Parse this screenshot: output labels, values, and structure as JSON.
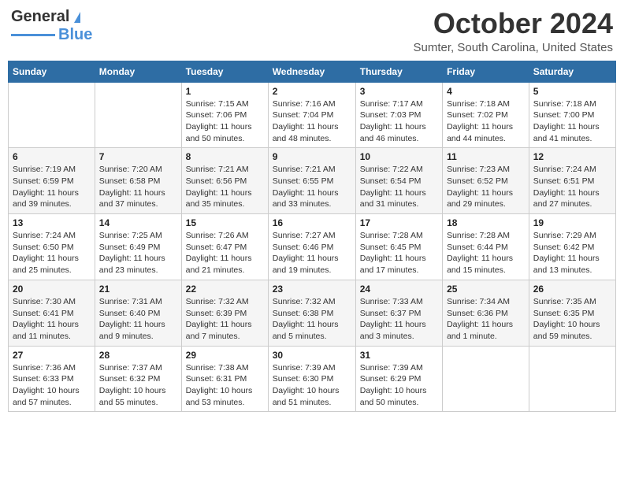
{
  "header": {
    "logo_line1": "General",
    "logo_line2": "Blue",
    "month": "October 2024",
    "location": "Sumter, South Carolina, United States"
  },
  "days_of_week": [
    "Sunday",
    "Monday",
    "Tuesday",
    "Wednesday",
    "Thursday",
    "Friday",
    "Saturday"
  ],
  "weeks": [
    [
      {
        "day": "",
        "sunrise": "",
        "sunset": "",
        "daylight": ""
      },
      {
        "day": "",
        "sunrise": "",
        "sunset": "",
        "daylight": ""
      },
      {
        "day": "1",
        "sunrise": "Sunrise: 7:15 AM",
        "sunset": "Sunset: 7:06 PM",
        "daylight": "Daylight: 11 hours and 50 minutes."
      },
      {
        "day": "2",
        "sunrise": "Sunrise: 7:16 AM",
        "sunset": "Sunset: 7:04 PM",
        "daylight": "Daylight: 11 hours and 48 minutes."
      },
      {
        "day": "3",
        "sunrise": "Sunrise: 7:17 AM",
        "sunset": "Sunset: 7:03 PM",
        "daylight": "Daylight: 11 hours and 46 minutes."
      },
      {
        "day": "4",
        "sunrise": "Sunrise: 7:18 AM",
        "sunset": "Sunset: 7:02 PM",
        "daylight": "Daylight: 11 hours and 44 minutes."
      },
      {
        "day": "5",
        "sunrise": "Sunrise: 7:18 AM",
        "sunset": "Sunset: 7:00 PM",
        "daylight": "Daylight: 11 hours and 41 minutes."
      }
    ],
    [
      {
        "day": "6",
        "sunrise": "Sunrise: 7:19 AM",
        "sunset": "Sunset: 6:59 PM",
        "daylight": "Daylight: 11 hours and 39 minutes."
      },
      {
        "day": "7",
        "sunrise": "Sunrise: 7:20 AM",
        "sunset": "Sunset: 6:58 PM",
        "daylight": "Daylight: 11 hours and 37 minutes."
      },
      {
        "day": "8",
        "sunrise": "Sunrise: 7:21 AM",
        "sunset": "Sunset: 6:56 PM",
        "daylight": "Daylight: 11 hours and 35 minutes."
      },
      {
        "day": "9",
        "sunrise": "Sunrise: 7:21 AM",
        "sunset": "Sunset: 6:55 PM",
        "daylight": "Daylight: 11 hours and 33 minutes."
      },
      {
        "day": "10",
        "sunrise": "Sunrise: 7:22 AM",
        "sunset": "Sunset: 6:54 PM",
        "daylight": "Daylight: 11 hours and 31 minutes."
      },
      {
        "day": "11",
        "sunrise": "Sunrise: 7:23 AM",
        "sunset": "Sunset: 6:52 PM",
        "daylight": "Daylight: 11 hours and 29 minutes."
      },
      {
        "day": "12",
        "sunrise": "Sunrise: 7:24 AM",
        "sunset": "Sunset: 6:51 PM",
        "daylight": "Daylight: 11 hours and 27 minutes."
      }
    ],
    [
      {
        "day": "13",
        "sunrise": "Sunrise: 7:24 AM",
        "sunset": "Sunset: 6:50 PM",
        "daylight": "Daylight: 11 hours and 25 minutes."
      },
      {
        "day": "14",
        "sunrise": "Sunrise: 7:25 AM",
        "sunset": "Sunset: 6:49 PM",
        "daylight": "Daylight: 11 hours and 23 minutes."
      },
      {
        "day": "15",
        "sunrise": "Sunrise: 7:26 AM",
        "sunset": "Sunset: 6:47 PM",
        "daylight": "Daylight: 11 hours and 21 minutes."
      },
      {
        "day": "16",
        "sunrise": "Sunrise: 7:27 AM",
        "sunset": "Sunset: 6:46 PM",
        "daylight": "Daylight: 11 hours and 19 minutes."
      },
      {
        "day": "17",
        "sunrise": "Sunrise: 7:28 AM",
        "sunset": "Sunset: 6:45 PM",
        "daylight": "Daylight: 11 hours and 17 minutes."
      },
      {
        "day": "18",
        "sunrise": "Sunrise: 7:28 AM",
        "sunset": "Sunset: 6:44 PM",
        "daylight": "Daylight: 11 hours and 15 minutes."
      },
      {
        "day": "19",
        "sunrise": "Sunrise: 7:29 AM",
        "sunset": "Sunset: 6:42 PM",
        "daylight": "Daylight: 11 hours and 13 minutes."
      }
    ],
    [
      {
        "day": "20",
        "sunrise": "Sunrise: 7:30 AM",
        "sunset": "Sunset: 6:41 PM",
        "daylight": "Daylight: 11 hours and 11 minutes."
      },
      {
        "day": "21",
        "sunrise": "Sunrise: 7:31 AM",
        "sunset": "Sunset: 6:40 PM",
        "daylight": "Daylight: 11 hours and 9 minutes."
      },
      {
        "day": "22",
        "sunrise": "Sunrise: 7:32 AM",
        "sunset": "Sunset: 6:39 PM",
        "daylight": "Daylight: 11 hours and 7 minutes."
      },
      {
        "day": "23",
        "sunrise": "Sunrise: 7:32 AM",
        "sunset": "Sunset: 6:38 PM",
        "daylight": "Daylight: 11 hours and 5 minutes."
      },
      {
        "day": "24",
        "sunrise": "Sunrise: 7:33 AM",
        "sunset": "Sunset: 6:37 PM",
        "daylight": "Daylight: 11 hours and 3 minutes."
      },
      {
        "day": "25",
        "sunrise": "Sunrise: 7:34 AM",
        "sunset": "Sunset: 6:36 PM",
        "daylight": "Daylight: 11 hours and 1 minute."
      },
      {
        "day": "26",
        "sunrise": "Sunrise: 7:35 AM",
        "sunset": "Sunset: 6:35 PM",
        "daylight": "Daylight: 10 hours and 59 minutes."
      }
    ],
    [
      {
        "day": "27",
        "sunrise": "Sunrise: 7:36 AM",
        "sunset": "Sunset: 6:33 PM",
        "daylight": "Daylight: 10 hours and 57 minutes."
      },
      {
        "day": "28",
        "sunrise": "Sunrise: 7:37 AM",
        "sunset": "Sunset: 6:32 PM",
        "daylight": "Daylight: 10 hours and 55 minutes."
      },
      {
        "day": "29",
        "sunrise": "Sunrise: 7:38 AM",
        "sunset": "Sunset: 6:31 PM",
        "daylight": "Daylight: 10 hours and 53 minutes."
      },
      {
        "day": "30",
        "sunrise": "Sunrise: 7:39 AM",
        "sunset": "Sunset: 6:30 PM",
        "daylight": "Daylight: 10 hours and 51 minutes."
      },
      {
        "day": "31",
        "sunrise": "Sunrise: 7:39 AM",
        "sunset": "Sunset: 6:29 PM",
        "daylight": "Daylight: 10 hours and 50 minutes."
      },
      {
        "day": "",
        "sunrise": "",
        "sunset": "",
        "daylight": ""
      },
      {
        "day": "",
        "sunrise": "",
        "sunset": "",
        "daylight": ""
      }
    ]
  ]
}
